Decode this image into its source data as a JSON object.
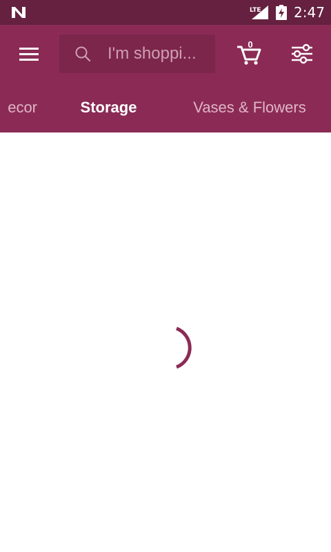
{
  "status_bar": {
    "network_label": "LTE",
    "time": "2:47",
    "icons": [
      "android-n-icon",
      "lte-signal-icon",
      "battery-charging-icon"
    ]
  },
  "app_bar": {
    "background": "#8b2b55",
    "status_background": "#65213f",
    "search": {
      "placeholder": "I'm shoppi..."
    },
    "cart": {
      "count": "0"
    },
    "icons": [
      "menu-icon",
      "search-icon",
      "cart-icon",
      "filter-icon"
    ]
  },
  "tabs": [
    {
      "label": "ecor",
      "active": false
    },
    {
      "label": "Storage",
      "active": true
    },
    {
      "label": "Vases & Flowers",
      "active": false
    }
  ],
  "content": {
    "loading": true,
    "spinner_color": "#8b2b55"
  }
}
